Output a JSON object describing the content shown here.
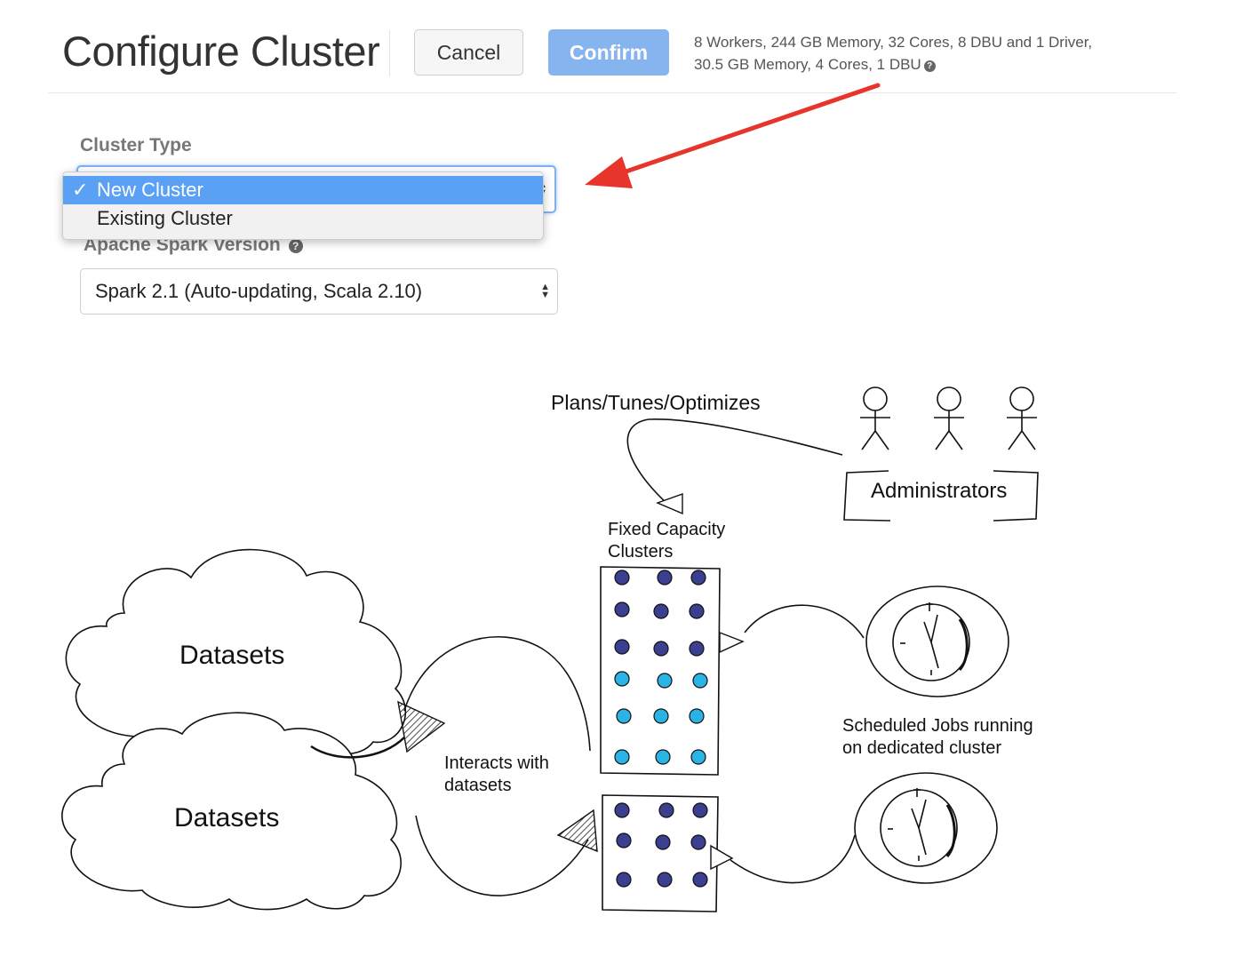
{
  "header": {
    "title": "Configure Cluster",
    "cancel_label": "Cancel",
    "confirm_label": "Confirm",
    "summary_line1": "8 Workers, 244 GB Memory, 32 Cores, 8 DBU and 1 Driver,",
    "summary_line2": "30.5 GB Memory, 4 Cores, 1 DBU"
  },
  "form": {
    "cluster_type_label": "Cluster Type",
    "cluster_type_options": [
      {
        "label": "New Cluster",
        "selected": true
      },
      {
        "label": "Existing Cluster",
        "selected": false
      }
    ],
    "check_mark": "✓",
    "spark_version_label": "Apache Spark Version",
    "spark_version_value": "Spark 2.1 (Auto-updating, Scala 2.10)"
  },
  "diagram": {
    "plans_label": "Plans/Tunes/Optimizes",
    "administrators_label": "Administrators",
    "fixed_capacity_line1": "Fixed Capacity",
    "fixed_capacity_line2": "Clusters",
    "datasets_top": "Datasets",
    "datasets_bottom": "Datasets",
    "interacts_line1": "Interacts with",
    "interacts_line2": "datasets",
    "scheduled_line1": "Scheduled Jobs running",
    "scheduled_line2": "on dedicated cluster"
  },
  "colors": {
    "confirm_button": "#86b4ee",
    "selected_option": "#5aa0f4",
    "arrow": "#e8352b",
    "node_dark": "#3a3f8f",
    "node_light": "#2ab4e6"
  },
  "icons": [
    "help-icon",
    "check-icon",
    "updown-arrows-icon",
    "stick-figure-icon",
    "clock-icon",
    "cloud-icon",
    "red-arrow-icon"
  ]
}
